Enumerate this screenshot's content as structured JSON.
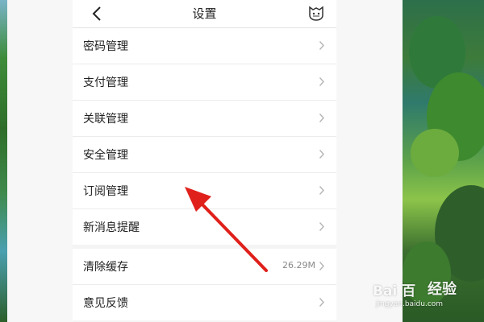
{
  "header": {
    "title": "设置",
    "back_icon": "chevron-left-icon",
    "mascot_icon": "mascot-icon"
  },
  "settings_group_1": [
    {
      "label": "密码管理"
    },
    {
      "label": "支付管理"
    },
    {
      "label": "关联管理"
    },
    {
      "label": "安全管理"
    },
    {
      "label": "订阅管理"
    },
    {
      "label": "新消息提醒"
    }
  ],
  "settings_group_2": [
    {
      "label": "清除缓存",
      "value": "26.29M"
    },
    {
      "label": "意见反馈"
    }
  ],
  "annotation": {
    "color": "#e0201b"
  },
  "watermark": {
    "brand": "Bai 百",
    "product": "经验",
    "url": "jingyan.baidu.com"
  },
  "colors": {
    "background": "#f4f4f4",
    "row_background": "#ffffff",
    "text": "#222222",
    "secondary_text": "#888888"
  }
}
